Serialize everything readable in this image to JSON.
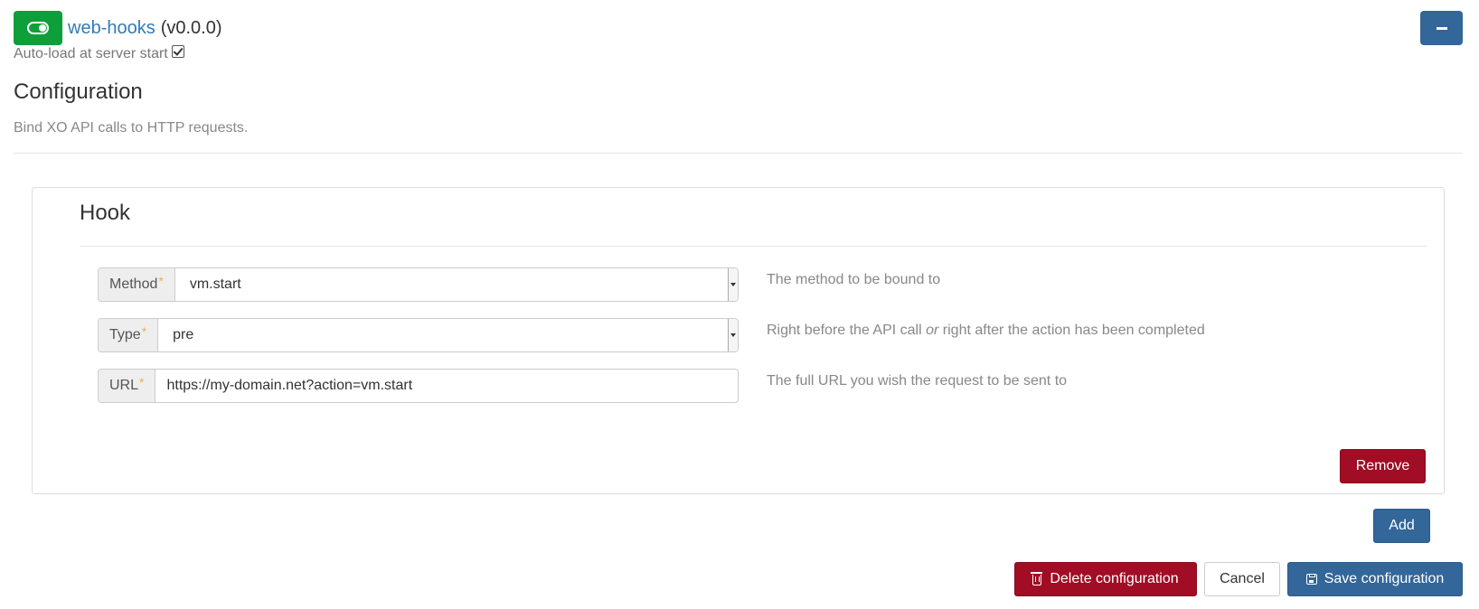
{
  "plugin": {
    "name": "web-hooks",
    "version": "(v0.0.0)",
    "autoload_label": "Auto-load at server start",
    "autoload_checked": true,
    "enabled": true,
    "accent_color": "#0e9f3a"
  },
  "configuration": {
    "title": "Configuration",
    "description": "Bind XO API calls to HTTP requests."
  },
  "hook": {
    "title": "Hook",
    "fields": {
      "method": {
        "label": "Method",
        "required_marker": "*",
        "value": "vm.start",
        "help": "The method to be bound to"
      },
      "type": {
        "label": "Type",
        "required_marker": "*",
        "value": "pre",
        "help_before": "Right before the API call ",
        "help_em": "or",
        "help_after": " right after the action has been completed"
      },
      "url": {
        "label": "URL",
        "required_marker": "*",
        "value": "https://my-domain.net?action=vm.start",
        "help": "The full URL you wish the request to be sent to"
      }
    },
    "remove_label": "Remove"
  },
  "actions": {
    "add_label": "Add",
    "delete_label": "Delete configuration",
    "cancel_label": "Cancel",
    "save_label": "Save configuration"
  },
  "colors": {
    "primary": "#336699",
    "danger": "#a00d25",
    "link": "#337ab7",
    "required": "#f0ad4e"
  },
  "icons": {
    "toggle": "toggle-on-icon",
    "collapse": "minus-icon",
    "delete": "trash-icon",
    "save": "floppy-disk-icon"
  }
}
